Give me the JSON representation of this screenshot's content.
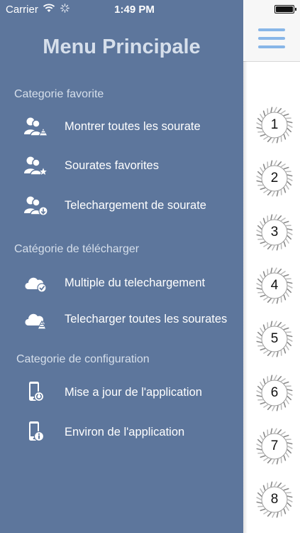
{
  "status_bar": {
    "carrier": "Carrier",
    "time": "1:49 PM"
  },
  "menu": {
    "title": "Menu Principale",
    "sections": [
      {
        "label": "Categorie favorite",
        "items": [
          {
            "label": "Montrer toutes les sourate",
            "icon": "users-list-icon"
          },
          {
            "label": "Sourates favorites",
            "icon": "users-star-icon"
          },
          {
            "label": "Telechargement de sourate",
            "icon": "users-download-icon"
          }
        ]
      },
      {
        "label": "Catégorie de télécharger",
        "items": [
          {
            "label": "Multiple du telechargement",
            "icon": "cloud-check-icon"
          },
          {
            "label": "Telecharger toutes les sourates",
            "icon": "cloud-list-icon"
          }
        ]
      },
      {
        "label": "Categorie de configuration",
        "items": [
          {
            "label": "Mise a jour de l'application",
            "icon": "phone-update-icon"
          },
          {
            "label": "Environ de l'application",
            "icon": "phone-info-icon"
          }
        ]
      }
    ]
  },
  "right_panel": {
    "numbers": [
      "1",
      "2",
      "3",
      "4",
      "5",
      "6",
      "7",
      "8"
    ]
  },
  "colors": {
    "menu_bg": "#5d769c",
    "menu_text": "#ffffff",
    "category_text": "#d6dfeb",
    "hamburger": "#88b6e8"
  }
}
